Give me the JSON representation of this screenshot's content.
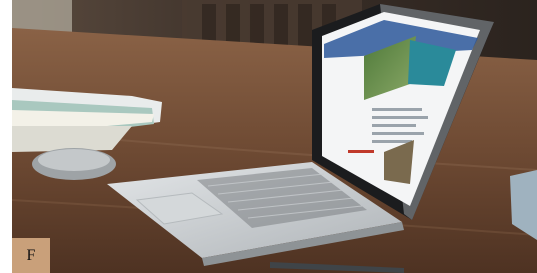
{
  "figure": {
    "label": "F"
  },
  "colors": {
    "background": "#ffffff",
    "label_bg": "#c9a07a",
    "wall": "#3a2f28",
    "table": "#6e4a33",
    "laptop": "#cfd3d6",
    "screen_accent": "#2a8a9a"
  }
}
